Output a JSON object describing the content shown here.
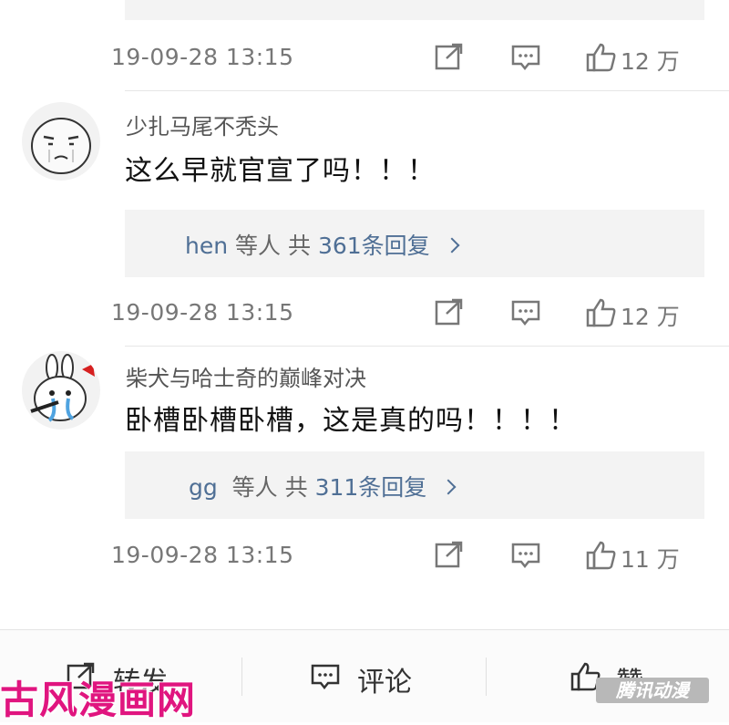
{
  "comments": [
    {
      "timestamp": "19-09-28  13:15",
      "likes": "12 万"
    },
    {
      "username": "少扎马尾不秃头",
      "text": "这么早就官宣了吗！！！",
      "reply": {
        "users": "hen",
        "mid": "等人",
        "gong": "共",
        "count_text": "361条回复"
      },
      "timestamp": "19-09-28  13:15",
      "likes": "12 万"
    },
    {
      "username": "柴犬与哈士奇的巅峰对决",
      "text": "卧槽卧槽卧槽，这是真的吗！！！！",
      "reply": {
        "users": "gg",
        "mid": "等人",
        "gong": "共",
        "count_text": "311条回复"
      },
      "timestamp": "19-09-28  13:15",
      "likes": "11 万"
    }
  ],
  "bottom_bar": {
    "repost_label": "转发",
    "comment_label": "评论",
    "like_label": "赞"
  },
  "watermarks": {
    "left": "古风漫画网",
    "right": "腾讯动漫"
  },
  "icons": [
    "share-icon",
    "comment-icon",
    "thumbs-up-icon",
    "repost-icon"
  ],
  "colors": {
    "link": "#4f6f95",
    "reply_bg": "#f3f3f3",
    "watermark_pink": "#e0157f"
  }
}
